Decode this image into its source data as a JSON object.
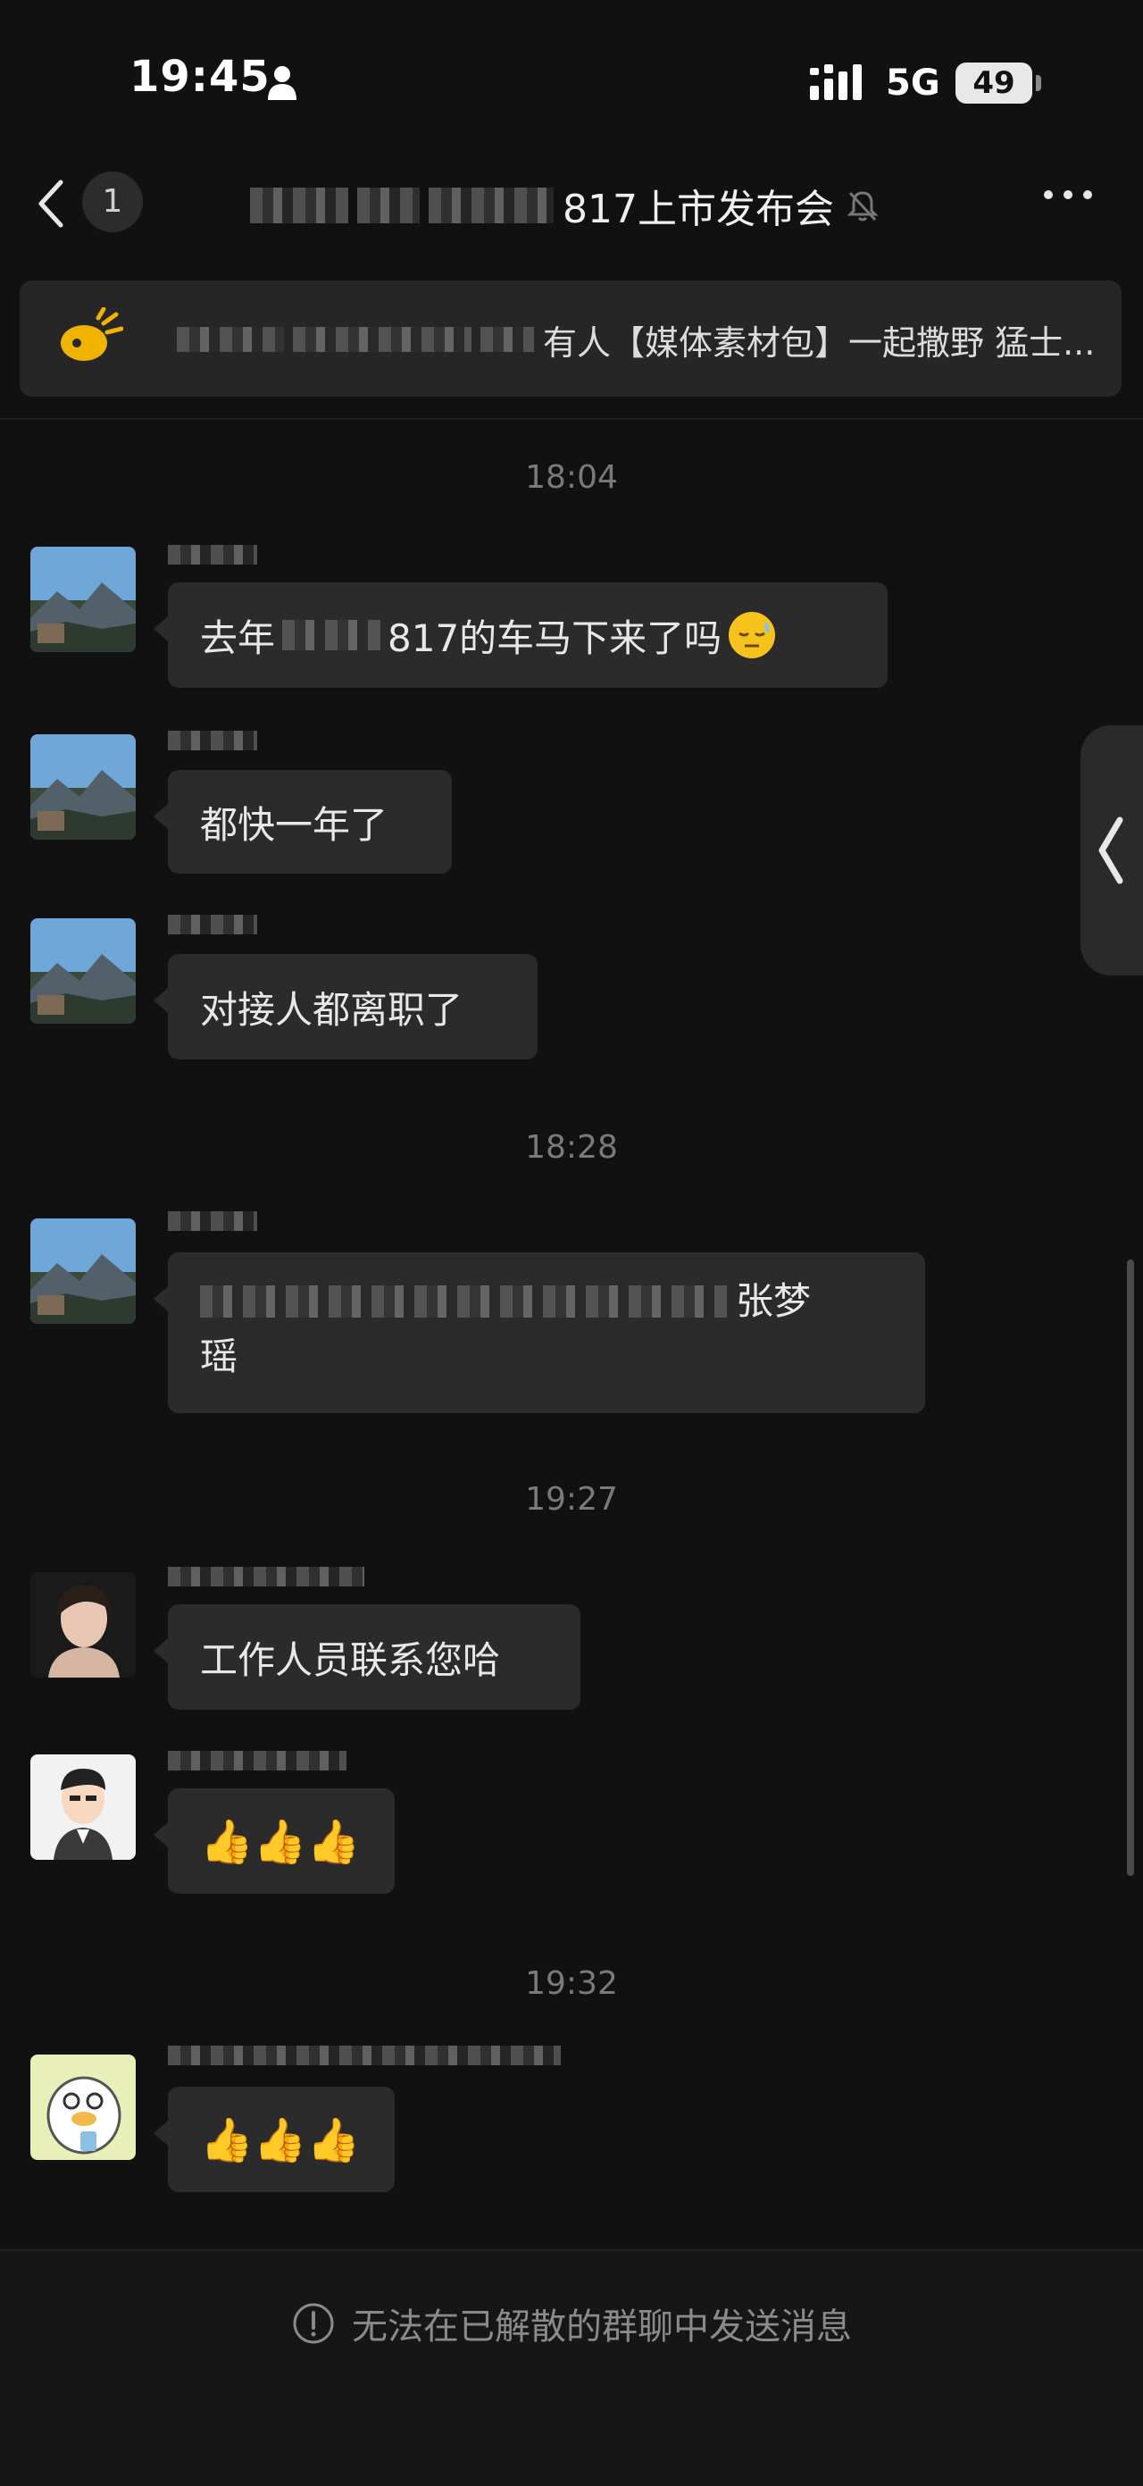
{
  "status_bar": {
    "time": "19:45",
    "network": "5G",
    "battery": "49"
  },
  "nav": {
    "unread_count": "1",
    "title_visible": "817上市发布会"
  },
  "announcement": {
    "text": "有人【媒体素材包】一起撒野 猛士..."
  },
  "messages": [
    {
      "time_label": "18:04",
      "bubble_prefix": "去年",
      "bubble_suffix": "817的车马下来了吗"
    },
    {
      "bubble": "都快一年了"
    },
    {
      "bubble": "对接人都离职了"
    },
    {
      "time_label": "18:28",
      "bubble_line1_tail": "张梦",
      "bubble_line2": "瑶"
    },
    {
      "time_label": "19:27",
      "bubble": "工作人员联系您哈"
    },
    {
      "bubble_emoji": "👍👍👍"
    },
    {
      "time_label": "19:32",
      "bubble_emoji": "👍👍👍"
    }
  ],
  "footer": {
    "notice": "无法在已解散的群聊中发送消息"
  },
  "icons": [
    "person-icon",
    "signal-icon",
    "back-arrow-icon",
    "mute-bell-icon",
    "more-icon",
    "megaphone-icon",
    "sleepy-emoji-icon",
    "chevron-left-icon",
    "info-icon"
  ],
  "colors": {
    "background": "#111111",
    "bubble": "#2b2b2b",
    "announcement_bg": "#262626",
    "time_text": "#7a7a7a",
    "megaphone": "#f0b400"
  }
}
